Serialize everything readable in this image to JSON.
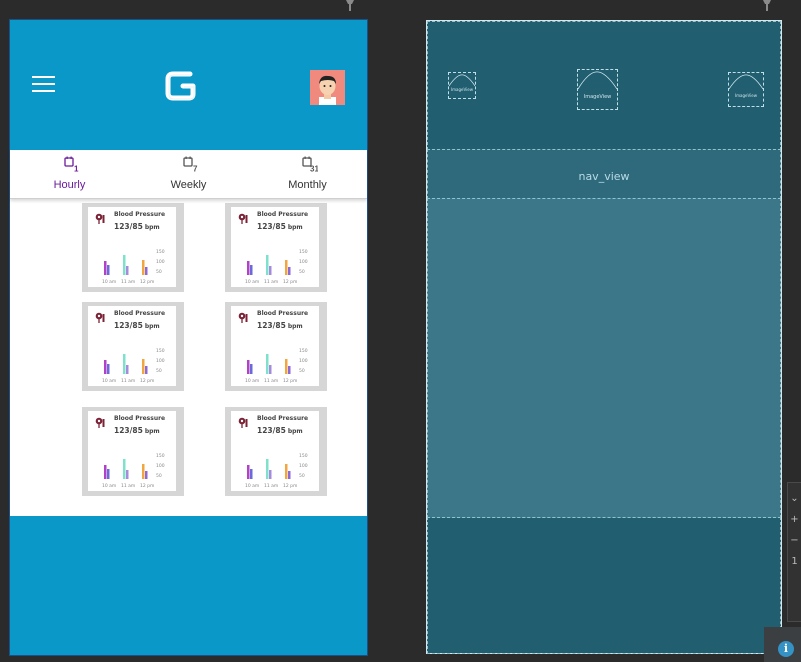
{
  "app": {
    "logo_letter": "G",
    "colors": {
      "primary": "#0a98c9",
      "tab_active": "#6a1b9a",
      "blueprint_bg": "#215e70"
    }
  },
  "tabs": [
    {
      "label": "Hourly",
      "icon_number": "1",
      "active": true
    },
    {
      "label": "Weekly",
      "icon_number": "7",
      "active": false
    },
    {
      "label": "Monthly",
      "icon_number": "31",
      "active": false
    }
  ],
  "cards": [
    {
      "title": "Blood Pressure",
      "value": "123/85",
      "unit": "bpm",
      "y_ticks": [
        "150",
        "100",
        "50"
      ],
      "x_ticks": [
        "10 am",
        "11 am",
        "12 pm"
      ]
    },
    {
      "title": "Blood Pressure",
      "value": "123/85",
      "unit": "bpm",
      "y_ticks": [
        "150",
        "100",
        "50"
      ],
      "x_ticks": [
        "10 am",
        "11 am",
        "12 pm"
      ]
    },
    {
      "title": "Blood Pressure",
      "value": "123/85",
      "unit": "bpm",
      "y_ticks": [
        "150",
        "100",
        "50"
      ],
      "x_ticks": [
        "10 am",
        "11 am",
        "12 pm"
      ]
    },
    {
      "title": "Blood Pressure",
      "value": "123/85",
      "unit": "bpm",
      "y_ticks": [
        "150",
        "100",
        "50"
      ],
      "x_ticks": [
        "10 am",
        "11 am",
        "12 pm"
      ]
    },
    {
      "title": "Blood Pressure",
      "value": "123/85",
      "unit": "bpm",
      "y_ticks": [
        "150",
        "100",
        "50"
      ],
      "x_ticks": [
        "10 am",
        "11 am",
        "12 pm"
      ]
    },
    {
      "title": "Blood Pressure",
      "value": "123/85",
      "unit": "bpm",
      "y_ticks": [
        "150",
        "100",
        "50"
      ],
      "x_ticks": [
        "10 am",
        "11 am",
        "12 pm"
      ]
    }
  ],
  "blueprint": {
    "image_left_label": "ImageView",
    "image_center_label": "ImageView",
    "image_right_label": "ImageView",
    "nav_label": "nav_view"
  },
  "icons": [
    "menu-icon",
    "logo-icon",
    "avatar",
    "calendar-icon",
    "blood-pressure-icon",
    "pin-icon",
    "info-icon"
  ]
}
